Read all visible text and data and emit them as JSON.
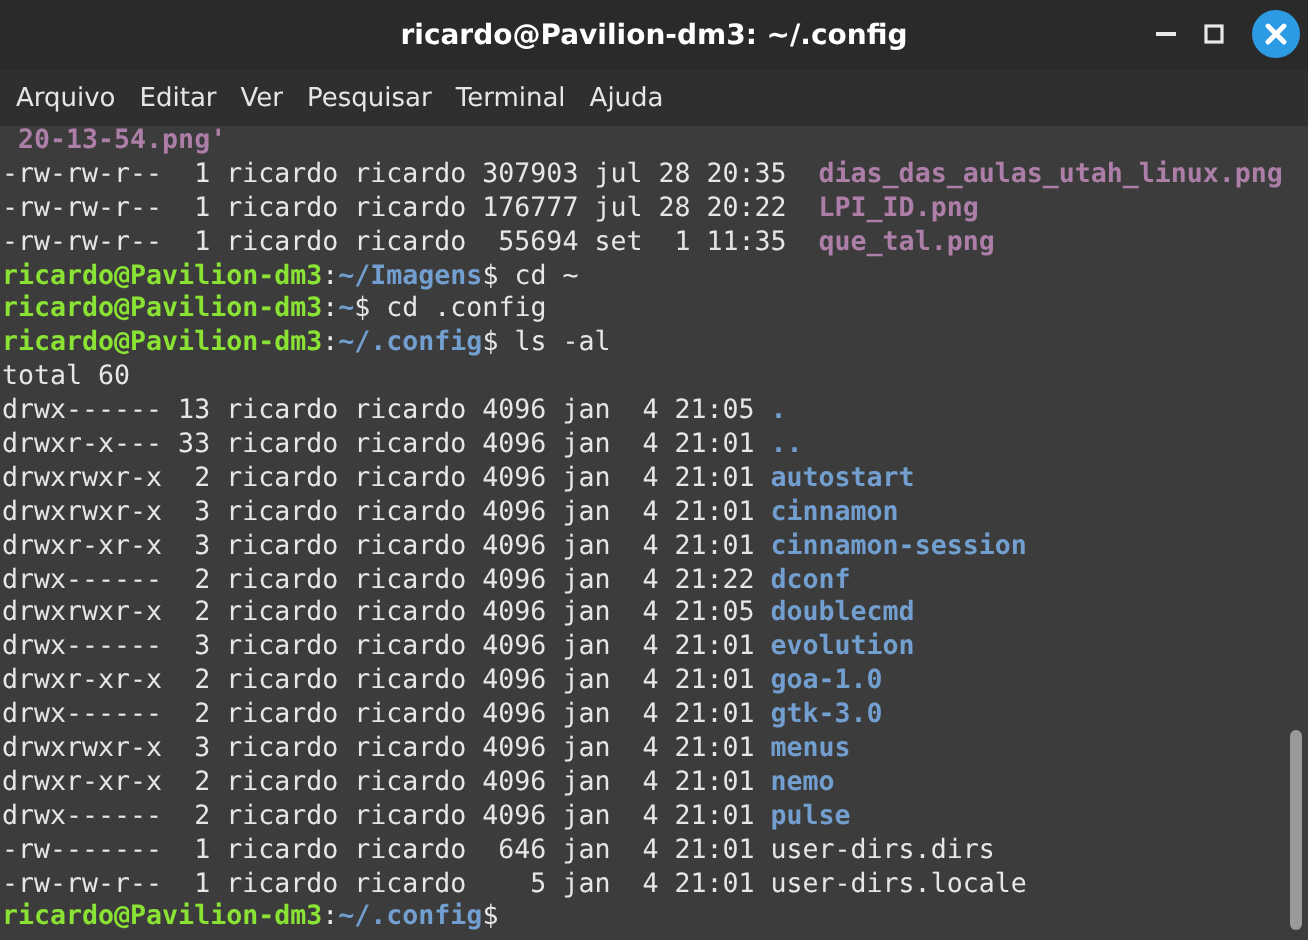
{
  "window": {
    "title": "ricardo@Pavilion-dm3: ~/.config"
  },
  "menu": [
    "Arquivo",
    "Editar",
    "Ver",
    "Pesquisar",
    "Terminal",
    "Ajuda"
  ],
  "terminal": {
    "lines": [
      [
        {
          "kind": "image",
          "text": " 20-13-54.png'"
        }
      ],
      [
        {
          "kind": "plain",
          "text": "-rw-rw-r--  1 ricardo ricardo 307903 jul 28 20:35  "
        },
        {
          "kind": "image",
          "text": "dias_das_aulas_utah_linux.png"
        }
      ],
      [
        {
          "kind": "plain",
          "text": "-rw-rw-r--  1 ricardo ricardo 176777 jul 28 20:22  "
        },
        {
          "kind": "image",
          "text": "LPI_ID.png"
        }
      ],
      [
        {
          "kind": "plain",
          "text": "-rw-rw-r--  1 ricardo ricardo  55694 set  1 11:35  "
        },
        {
          "kind": "image",
          "text": "que_tal.png"
        }
      ],
      [
        {
          "kind": "user",
          "text": "ricardo@Pavilion-dm3"
        },
        {
          "kind": "plain",
          "text": ":"
        },
        {
          "kind": "path",
          "text": "~/Imagens"
        },
        {
          "kind": "plain",
          "text": "$ cd ~"
        }
      ],
      [
        {
          "kind": "user",
          "text": "ricardo@Pavilion-dm3"
        },
        {
          "kind": "plain",
          "text": ":"
        },
        {
          "kind": "path",
          "text": "~"
        },
        {
          "kind": "plain",
          "text": "$ cd .config"
        }
      ],
      [
        {
          "kind": "user",
          "text": "ricardo@Pavilion-dm3"
        },
        {
          "kind": "plain",
          "text": ":"
        },
        {
          "kind": "path",
          "text": "~/.config"
        },
        {
          "kind": "plain",
          "text": "$ ls -al"
        }
      ],
      [
        {
          "kind": "plain",
          "text": "total 60"
        }
      ],
      [
        {
          "kind": "plain",
          "text": "drwx------ 13 ricardo ricardo 4096 jan  4 21:05 "
        },
        {
          "kind": "dir",
          "text": "."
        }
      ],
      [
        {
          "kind": "plain",
          "text": "drwxr-x--- 33 ricardo ricardo 4096 jan  4 21:01 "
        },
        {
          "kind": "dir",
          "text": ".."
        }
      ],
      [
        {
          "kind": "plain",
          "text": "drwxrwxr-x  2 ricardo ricardo 4096 jan  4 21:01 "
        },
        {
          "kind": "dir",
          "text": "autostart"
        }
      ],
      [
        {
          "kind": "plain",
          "text": "drwxrwxr-x  3 ricardo ricardo 4096 jan  4 21:01 "
        },
        {
          "kind": "dir",
          "text": "cinnamon"
        }
      ],
      [
        {
          "kind": "plain",
          "text": "drwxr-xr-x  3 ricardo ricardo 4096 jan  4 21:01 "
        },
        {
          "kind": "dir",
          "text": "cinnamon-session"
        }
      ],
      [
        {
          "kind": "plain",
          "text": "drwx------  2 ricardo ricardo 4096 jan  4 21:22 "
        },
        {
          "kind": "dir",
          "text": "dconf"
        }
      ],
      [
        {
          "kind": "plain",
          "text": "drwxrwxr-x  2 ricardo ricardo 4096 jan  4 21:05 "
        },
        {
          "kind": "dir",
          "text": "doublecmd"
        }
      ],
      [
        {
          "kind": "plain",
          "text": "drwx------  3 ricardo ricardo 4096 jan  4 21:01 "
        },
        {
          "kind": "dir",
          "text": "evolution"
        }
      ],
      [
        {
          "kind": "plain",
          "text": "drwxr-xr-x  2 ricardo ricardo 4096 jan  4 21:01 "
        },
        {
          "kind": "dir",
          "text": "goa-1.0"
        }
      ],
      [
        {
          "kind": "plain",
          "text": "drwx------  2 ricardo ricardo 4096 jan  4 21:01 "
        },
        {
          "kind": "dir",
          "text": "gtk-3.0"
        }
      ],
      [
        {
          "kind": "plain",
          "text": "drwxrwxr-x  3 ricardo ricardo 4096 jan  4 21:01 "
        },
        {
          "kind": "dir",
          "text": "menus"
        }
      ],
      [
        {
          "kind": "plain",
          "text": "drwxr-xr-x  2 ricardo ricardo 4096 jan  4 21:01 "
        },
        {
          "kind": "dir",
          "text": "nemo"
        }
      ],
      [
        {
          "kind": "plain",
          "text": "drwx------  2 ricardo ricardo 4096 jan  4 21:01 "
        },
        {
          "kind": "dir",
          "text": "pulse"
        }
      ],
      [
        {
          "kind": "plain",
          "text": "-rw-------  1 ricardo ricardo  646 jan  4 21:01 user-dirs.dirs"
        }
      ],
      [
        {
          "kind": "plain",
          "text": "-rw-rw-r--  1 ricardo ricardo    5 jan  4 21:01 user-dirs.locale"
        }
      ],
      [
        {
          "kind": "user",
          "text": "ricardo@Pavilion-dm3"
        },
        {
          "kind": "plain",
          "text": ":"
        },
        {
          "kind": "path",
          "text": "~/.config"
        },
        {
          "kind": "plain",
          "text": "$"
        }
      ]
    ]
  }
}
